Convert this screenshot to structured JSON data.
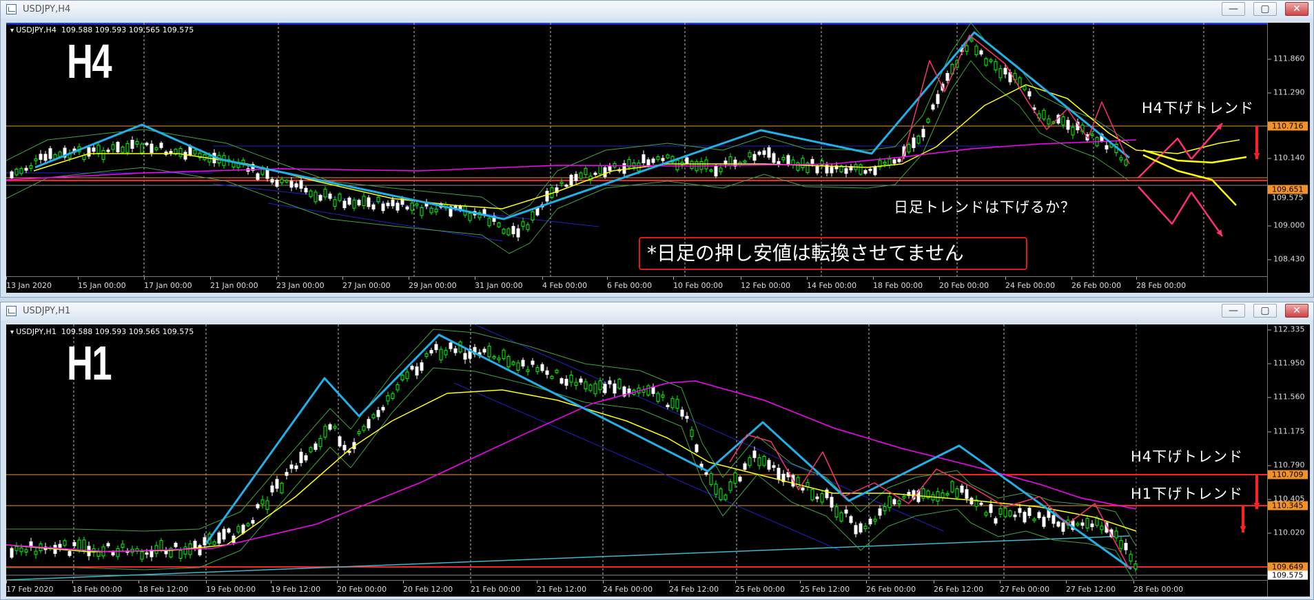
{
  "top_window": {
    "title": "USDJPY,H4",
    "info": "USDJPY,H4  109.588 109.593 109.565 109.575",
    "timeframe": "H4",
    "price_labels": [
      "111.860",
      "111.290",
      "110.140",
      "109.000",
      "108.430"
    ],
    "price_tags": [
      "110.716",
      "109.651",
      "109.575"
    ],
    "time_labels": [
      "13 Jan 2020",
      "15 Jan 00:00",
      "17 Jan 00:00",
      "21 Jan 00:00",
      "23 Jan 00:00",
      "27 Jan 00:00",
      "29 Jan 00:00",
      "31 Jan 00:00",
      "4 Feb 00:00",
      "6 Feb 00:00",
      "10 Feb 00:00",
      "12 Feb 00:00",
      "14 Feb 00:00",
      "18 Feb 00:00",
      "20 Feb 00:00",
      "24 Feb 00:00",
      "26 Feb 00:00",
      "28 Feb 00:00"
    ],
    "annotation_h4_trend": "H4下げトレンド",
    "annotation_daily": "日足トレンドは下げるか？",
    "note": "*日足の押し安値は転換させてません"
  },
  "bottom_window": {
    "title": "USDJPY,H1",
    "info": "USDJPY,H1  109.588 109.593 109.565 109.575",
    "timeframe": "H1",
    "price_labels": [
      "112.335",
      "111.950",
      "111.560",
      "111.175",
      "110.790",
      "110.405",
      "110.020"
    ],
    "price_tags": [
      "110.709",
      "110.345",
      "109.649",
      "109.575"
    ],
    "time_labels": [
      "17 Feb 2020",
      "18 Feb 00:00",
      "18 Feb 12:00",
      "19 Feb 00:00",
      "19 Feb 12:00",
      "20 Feb 00:00",
      "20 Feb 12:00",
      "21 Feb 00:00",
      "21 Feb 12:00",
      "24 Feb 00:00",
      "24 Feb 12:00",
      "25 Feb 00:00",
      "25 Feb 12:00",
      "26 Feb 00:00",
      "26 Feb 12:00",
      "27 Feb 00:00",
      "27 Feb 12:00",
      "28 Feb 00:00"
    ],
    "annotation_h4_trend": "H4下げトレンド",
    "annotation_h1_trend": "H1下げトレンド"
  },
  "controls": {
    "minimize": "—",
    "maximize": "▢",
    "close": "✕"
  },
  "colors": {
    "background": "#000000",
    "bull": "#00ff00",
    "zigzag": "#1fb2ea",
    "ma_fast": "#ffff00",
    "ma_slow": "#ff00ff",
    "level": "#ff2020",
    "tag": "#f0912a"
  }
}
